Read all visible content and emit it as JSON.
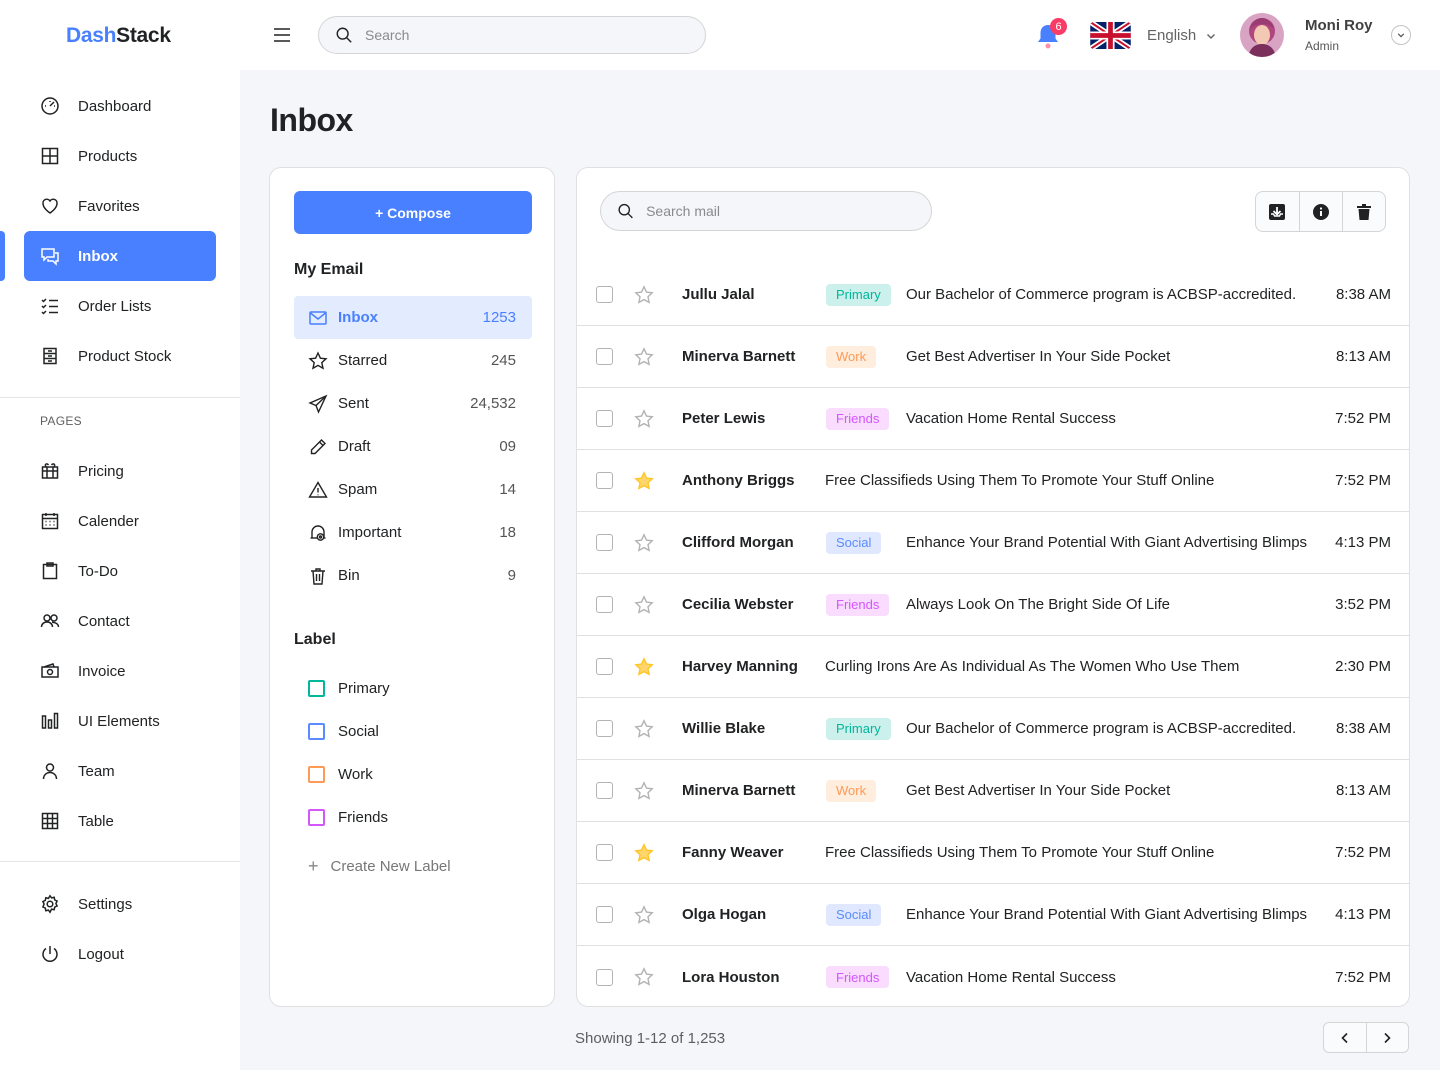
{
  "app": {
    "logo_part1": "Dash",
    "logo_part2": "Stack"
  },
  "sidebar": {
    "main_items": [
      {
        "label": "Dashboard",
        "icon": "dashboard-icon"
      },
      {
        "label": "Products",
        "icon": "grid-icon"
      },
      {
        "label": "Favorites",
        "icon": "heart-icon"
      },
      {
        "label": "Inbox",
        "icon": "inbox-icon",
        "active": true
      },
      {
        "label": "Order Lists",
        "icon": "list-icon"
      },
      {
        "label": "Product Stock",
        "icon": "stock-icon"
      }
    ],
    "pages_label": "PAGES",
    "page_items": [
      {
        "label": "Pricing",
        "icon": "gift-icon"
      },
      {
        "label": "Calender",
        "icon": "calendar-icon"
      },
      {
        "label": "To-Do",
        "icon": "clipboard-icon"
      },
      {
        "label": "Contact",
        "icon": "contact-icon"
      },
      {
        "label": "Invoice",
        "icon": "invoice-icon"
      },
      {
        "label": "UI Elements",
        "icon": "chart-bars-icon"
      },
      {
        "label": "Team",
        "icon": "user-icon"
      },
      {
        "label": "Table",
        "icon": "table-icon"
      }
    ],
    "bottom_items": [
      {
        "label": "Settings",
        "icon": "gear-icon"
      },
      {
        "label": "Logout",
        "icon": "power-icon"
      }
    ]
  },
  "topbar": {
    "search_placeholder": "Search",
    "notification_count": "6",
    "language": "English",
    "user_name": "Moni Roy",
    "user_role": "Admin"
  },
  "page": {
    "title": "Inbox"
  },
  "mailbox": {
    "compose_label": "+ Compose",
    "my_email_heading": "My Email",
    "folders": [
      {
        "label": "Inbox",
        "count": "1253",
        "icon": "mail-icon",
        "active": true
      },
      {
        "label": "Starred",
        "count": "245",
        "icon": "star-icon"
      },
      {
        "label": "Sent",
        "count": "24,532",
        "icon": "send-icon"
      },
      {
        "label": "Draft",
        "count": "09",
        "icon": "pencil-icon"
      },
      {
        "label": "Spam",
        "count": "14",
        "icon": "warning-icon"
      },
      {
        "label": "Important",
        "count": "18",
        "icon": "important-icon"
      },
      {
        "label": "Bin",
        "count": "9",
        "icon": "trash-icon"
      }
    ],
    "label_heading": "Label",
    "labels": [
      {
        "label": "Primary",
        "color": "#00b69b"
      },
      {
        "label": "Social",
        "color": "#5a8cff"
      },
      {
        "label": "Work",
        "color": "#fd9a56"
      },
      {
        "label": "Friends",
        "color": "#d456fd"
      }
    ],
    "create_label": "Create New Label"
  },
  "mail_list": {
    "search_placeholder": "Search mail",
    "toolbar_icons": [
      "download-icon",
      "info-icon",
      "trash-icon"
    ],
    "emails": [
      {
        "sender": "Jullu Jalal",
        "tag": "Primary",
        "subject": "Our Bachelor of Commerce program is ACBSP-accredited.",
        "time": "8:38 AM",
        "starred": false
      },
      {
        "sender": "Minerva Barnett",
        "tag": "Work",
        "subject": "Get Best Advertiser In Your Side Pocket",
        "time": "8:13 AM",
        "starred": false
      },
      {
        "sender": "Peter Lewis",
        "tag": "Friends",
        "subject": "Vacation Home Rental Success",
        "time": "7:52 PM",
        "starred": false
      },
      {
        "sender": "Anthony Briggs",
        "tag": "",
        "subject": "Free Classifieds Using Them To Promote Your Stuff Online",
        "time": "7:52 PM",
        "starred": true
      },
      {
        "sender": "Clifford Morgan",
        "tag": "Social",
        "subject": "Enhance Your Brand Potential With Giant Advertising Blimps",
        "time": "4:13 PM",
        "starred": false
      },
      {
        "sender": "Cecilia Webster",
        "tag": "Friends",
        "subject": "Always Look On The Bright Side Of Life",
        "time": "3:52 PM",
        "starred": false
      },
      {
        "sender": "Harvey Manning",
        "tag": "",
        "subject": "Curling Irons Are As Individual As The Women Who Use Them",
        "time": "2:30 PM",
        "starred": true
      },
      {
        "sender": "Willie Blake",
        "tag": "Primary",
        "subject": "Our Bachelor of Commerce program is ACBSP-accredited.",
        "time": "8:38 AM",
        "starred": false
      },
      {
        "sender": "Minerva Barnett",
        "tag": "Work",
        "subject": "Get Best Advertiser In Your Side Pocket",
        "time": "8:13 AM",
        "starred": false
      },
      {
        "sender": "Fanny Weaver",
        "tag": "",
        "subject": "Free Classifieds Using Them To Promote Your Stuff Online",
        "time": "7:52 PM",
        "starred": true
      },
      {
        "sender": "Olga Hogan",
        "tag": "Social",
        "subject": "Enhance Your Brand Potential With Giant Advertising Blimps",
        "time": "4:13 PM",
        "starred": false
      },
      {
        "sender": "Lora Houston",
        "tag": "Friends",
        "subject": "Vacation Home Rental Success",
        "time": "7:52 PM",
        "starred": false
      }
    ],
    "pagination_text": "Showing 1-12 of 1,253"
  }
}
